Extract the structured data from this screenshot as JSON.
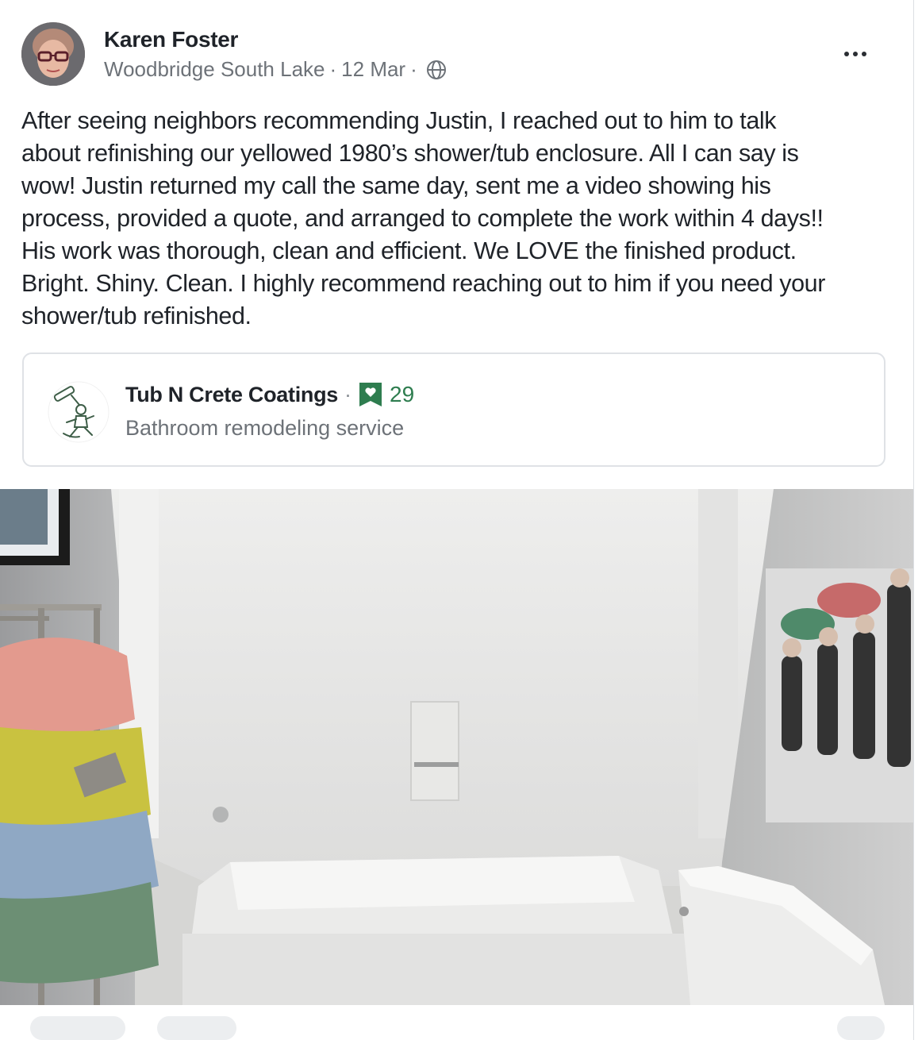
{
  "post": {
    "author": "Karen Foster",
    "neighborhood": "Woodbridge South Lake",
    "date": "12 Mar",
    "separator": "·",
    "visibility_icon": "globe-icon",
    "more_icon": "more-horizontal-icon",
    "body_lines": [
      "After seeing neighbors recommending Justin, I reached out to him to talk",
      "about refinishing our yellowed 1980’s shower/tub enclosure.  All I can say is",
      "wow! Justin returned my call the same day, sent me a video showing his",
      "process, provided a quote, and arranged to complete the work within 4 days!!",
      "His work was thorough, clean and efficient. We LOVE the finished product.",
      "Bright. Shiny. Clean. I highly recommend reaching out to him if you need your",
      "shower/tub refinished."
    ]
  },
  "business": {
    "name": "Tub N Crete Coatings",
    "separator": "·",
    "fave_count": "29",
    "category": "Bathroom remodeling service",
    "fave_icon": "neighborhood-fave-icon",
    "logo_icon": "handyman-logo-icon"
  },
  "colors": {
    "fave_green": "#2e7d4f",
    "text_primary": "#1f2329",
    "text_secondary": "#6d7278"
  }
}
